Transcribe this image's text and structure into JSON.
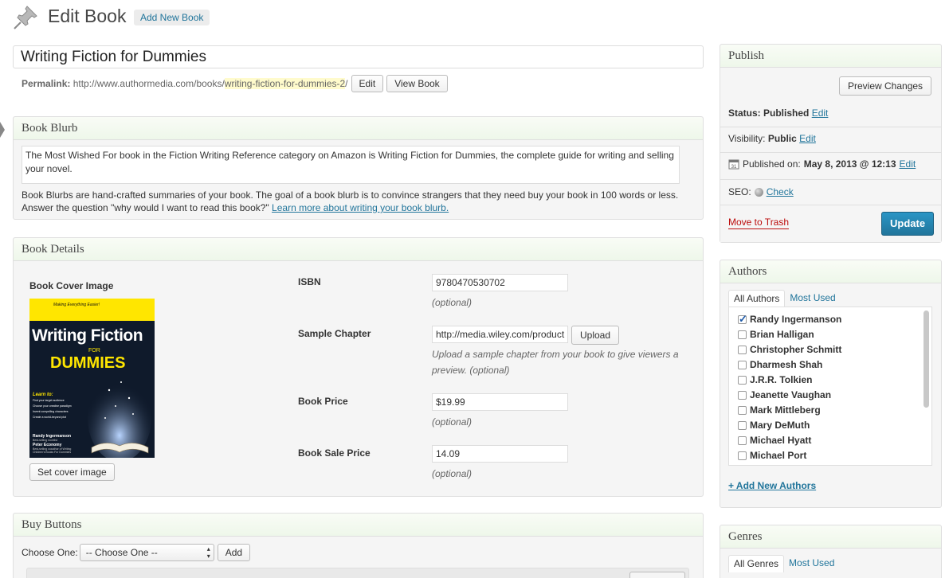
{
  "header": {
    "title": "Edit Book",
    "add_new_label": "Add New Book"
  },
  "post": {
    "title": "Writing Fiction for Dummies",
    "permalink_label": "Permalink:",
    "permalink_base": "http://www.authormedia.com/books/",
    "permalink_slug": "writing-fiction-for-dummies-2",
    "permalink_trail": "/",
    "edit_label": "Edit",
    "view_label": "View Book"
  },
  "blurb": {
    "title": "Book Blurb",
    "text": "The Most Wished For book in the Fiction Writing Reference category on Amazon is Writing Fiction for Dummies, the complete guide for writing and selling your novel.",
    "help": "Book Blurbs are hand-crafted summaries of your book. The goal of a book blurb is to convince strangers that they need buy your book in 100 words or less. Answer the question \"why would I want to read this book?\"",
    "help_link": "Learn more about writing your book blurb."
  },
  "details": {
    "title": "Book Details",
    "cover_label": "Book Cover Image",
    "set_cover_label": "Set cover image",
    "cover_image": {
      "top_line": "Making Everything Easier!",
      "title_line1": "Writing Fiction",
      "title_for": "FOR",
      "title_line2": "DUMMIES",
      "learn_to": "Learn to:",
      "bullets": [
        "Find your target audience",
        "Choose your creative paradigm",
        "Invent compelling characters",
        "Create a world-beyond plot"
      ],
      "author1": "Randy Ingermanson",
      "author1_sub": "Best-selling novelist",
      "author2": "Peter Economy",
      "author2_sub": "Best-selling coauthor of Writing Children's Books For Dummies"
    },
    "isbn_label": "ISBN",
    "isbn_value": "9780470530702",
    "isbn_help": "(optional)",
    "sample_label": "Sample Chapter",
    "sample_value": "http://media.wiley.com/product",
    "upload_label": "Upload",
    "sample_help": "Upload a sample chapter from your book to give viewers a preview. (optional)",
    "price_label": "Book Price",
    "price_value": "$19.99",
    "price_help": "(optional)",
    "sale_label": "Book Sale Price",
    "sale_value": "14.09",
    "sale_help": "(optional)"
  },
  "buy": {
    "title": "Buy Buttons",
    "choose_label": "Choose One:",
    "select_value": "-- Choose One --",
    "add_label": "Add"
  },
  "publish": {
    "title": "Publish",
    "preview_label": "Preview Changes",
    "status_label": "Status:",
    "status_value": "Published",
    "visibility_label": "Visibility:",
    "visibility_value": "Public",
    "published_label": "Published on:",
    "published_value": "May 8, 2013 @ 12:13",
    "edit_label": "Edit",
    "seo_label": "SEO:",
    "seo_link": "Check",
    "trash_label": "Move to Trash",
    "update_label": "Update"
  },
  "authors": {
    "title": "Authors",
    "tab_all": "All Authors",
    "tab_used": "Most Used",
    "items": [
      {
        "name": "Randy Ingermanson",
        "checked": true
      },
      {
        "name": "Brian Halligan",
        "checked": false
      },
      {
        "name": "Christopher Schmitt",
        "checked": false
      },
      {
        "name": "Dharmesh Shah",
        "checked": false
      },
      {
        "name": "J.R.R. Tolkien",
        "checked": false
      },
      {
        "name": "Jeanette Vaughan",
        "checked": false
      },
      {
        "name": "Mark Mittleberg",
        "checked": false
      },
      {
        "name": "Mary DeMuth",
        "checked": false
      },
      {
        "name": "Michael Hyatt",
        "checked": false
      },
      {
        "name": "Michael Port",
        "checked": false
      }
    ],
    "add_new_label": "+ Add New Authors"
  },
  "genres": {
    "title": "Genres",
    "tab_all": "All Genres",
    "tab_used": "Most Used"
  }
}
